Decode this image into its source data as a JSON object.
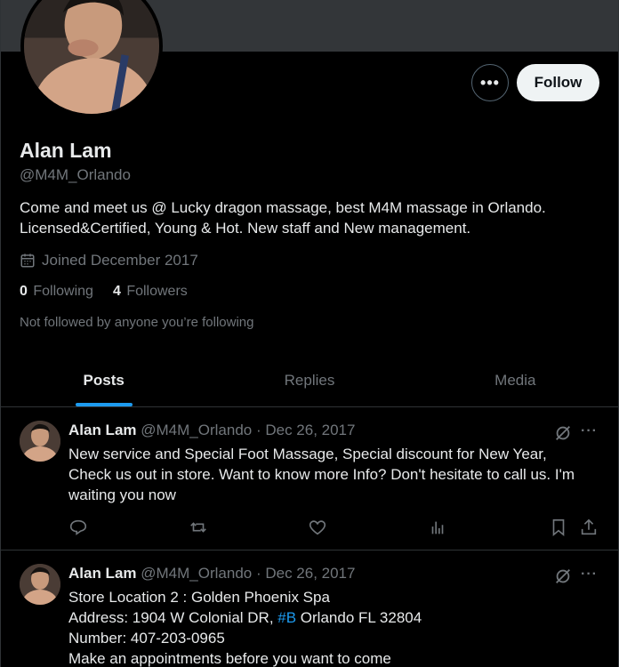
{
  "profile": {
    "name": "Alan Lam",
    "handle": "@M4M_Orlando",
    "bio_line1": "Come and meet us @ Lucky dragon massage, best M4M massage in Orlando.",
    "bio_line2": "Licensed&Certified, Young & Hot. New staff and New management.",
    "joined": "Joined December 2017",
    "following_count": "0",
    "following_label": "Following",
    "followers_count": "4",
    "followers_label": "Followers",
    "not_followed": "Not followed by anyone you’re following"
  },
  "header": {
    "more_label": "•••",
    "follow_label": "Follow"
  },
  "tabs": [
    {
      "label": "Posts",
      "active": true
    },
    {
      "label": "Replies",
      "active": false
    },
    {
      "label": "Media",
      "active": false
    }
  ],
  "posts": [
    {
      "name": "Alan Lam",
      "meta": "@M4M_Orlando · Dec 26, 2017",
      "lines": [
        "New service and Special Foot Massage, Special discount for New Year,",
        "Check us out in store. Want to know more Info? Don't hesitate to call us. I'm",
        "waiting you now"
      ]
    },
    {
      "name": "Alan Lam",
      "meta": "@M4M_Orlando · Dec 26, 2017",
      "line1": "Store Location 2 : Golden Phoenix Spa",
      "line2_pre": "Address: 1904 W Colonial DR, ",
      "line2_tag": "#B",
      "line2_post": " Orlando FL 32804",
      "line3": "Number: 407-203-0965",
      "line4": "Make an appointments before you want to come"
    }
  ],
  "icons": {
    "calendar": "calendar-icon",
    "reply": "reply-icon",
    "repost": "repost-icon",
    "like": "like-icon",
    "views": "views-icon",
    "bookmark": "bookmark-icon",
    "share": "share-icon",
    "grok": "grok-icon",
    "more": "more-icon"
  },
  "colors": {
    "background": "#000000",
    "text": "#e7e9ea",
    "muted": "#71767b",
    "accent": "#1d9bf0",
    "border": "#2f3336"
  },
  "dots_glyph": "···"
}
